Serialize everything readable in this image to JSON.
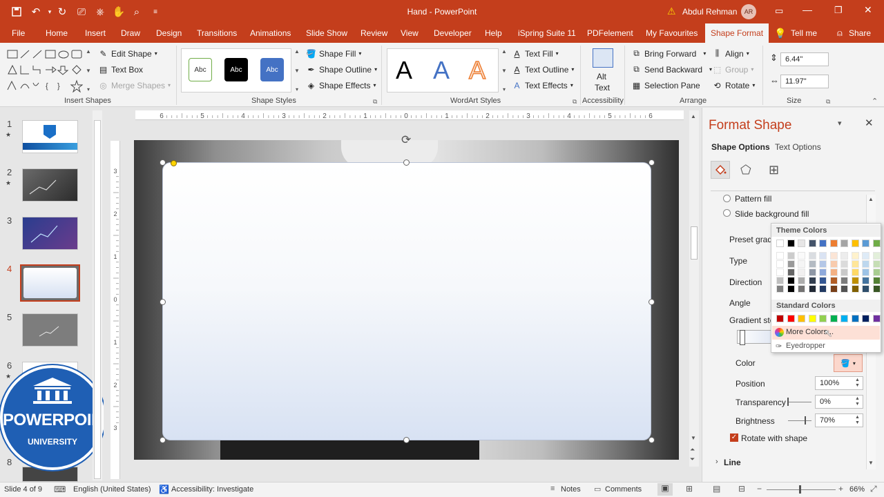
{
  "window": {
    "title": "Hand - PowerPoint",
    "user": "Abdul Rehman",
    "user_initials": "AR",
    "warning_icon": "warning-icon"
  },
  "tabs": [
    "File",
    "Home",
    "Insert",
    "Draw",
    "Design",
    "Transitions",
    "Animations",
    "Slide Show",
    "Review",
    "View",
    "Developer",
    "Help",
    "iSpring Suite 11",
    "PDFelement",
    "My Favourites",
    "Shape Format",
    "Tell me",
    "Share"
  ],
  "active_tab": "Shape Format",
  "ribbon": {
    "insert_shapes": {
      "label": "Insert Shapes",
      "edit_shape": "Edit Shape",
      "text_box": "Text Box",
      "merge_shapes": "Merge Shapes"
    },
    "shape_styles": {
      "label": "Shape Styles",
      "swatches": [
        "Abc",
        "Abc",
        "Abc"
      ],
      "shape_fill": "Shape Fill",
      "shape_outline": "Shape Outline",
      "shape_effects": "Shape Effects"
    },
    "wordart": {
      "label": "WordArt Styles",
      "letters": [
        "A",
        "A",
        "A"
      ],
      "text_fill": "Text Fill",
      "text_outline": "Text Outline",
      "text_effects": "Text Effects"
    },
    "accessibility": {
      "label": "Accessibility",
      "alt_text_1": "Alt",
      "alt_text_2": "Text"
    },
    "arrange": {
      "label": "Arrange",
      "bring_forward": "Bring Forward",
      "send_backward": "Send Backward",
      "selection_pane": "Selection Pane",
      "align": "Align",
      "group": "Group",
      "rotate": "Rotate"
    },
    "size": {
      "label": "Size",
      "height": "6.44\"",
      "width": "11.97\""
    }
  },
  "slides": [
    {
      "num": "1",
      "star": "★"
    },
    {
      "num": "2",
      "star": "★"
    },
    {
      "num": "3",
      "star": ""
    },
    {
      "num": "4",
      "star": ""
    },
    {
      "num": "5",
      "star": ""
    },
    {
      "num": "6",
      "star": "★"
    },
    {
      "num": "8",
      "star": ""
    }
  ],
  "ruler_h": [
    "6",
    "5",
    "4",
    "3",
    "2",
    "1",
    "0",
    "1",
    "2",
    "3",
    "4",
    "5",
    "6"
  ],
  "ruler_v": [
    "3",
    "2",
    "1",
    "0",
    "1",
    "2",
    "3"
  ],
  "watermark": {
    "line1": "POWERPOINT",
    "line2": "UNIVERSITY"
  },
  "format_pane": {
    "title": "Format Shape",
    "tab_shape": "Shape Options",
    "tab_text": "Text Options",
    "pattern_fill": "Pattern fill",
    "slide_bg_fill": "Slide background fill",
    "preset": "Preset gradi",
    "type": "Type",
    "direction": "Direction",
    "angle": "Angle",
    "gradient_stops": "Gradient sto",
    "color": "Color",
    "position": "Position",
    "position_val": "100%",
    "transparency": "Transparency",
    "transparency_val": "0%",
    "brightness": "Brightness",
    "brightness_val": "70%",
    "rotate_with_shape": "Rotate with shape",
    "line": "Line"
  },
  "color_popup": {
    "theme_colors": "Theme Colors",
    "standard_colors": "Standard Colors",
    "more_colors": "More Colors...",
    "eyedropper": "Eyedropper",
    "theme_top": [
      "#ffffff",
      "#000000",
      "#e7e6e6",
      "#44546a",
      "#4472c4",
      "#ed7d31",
      "#a5a5a5",
      "#ffc000",
      "#5b9bd5",
      "#70ad47"
    ],
    "standard": [
      "#c00000",
      "#ff0000",
      "#ffc000",
      "#ffff00",
      "#92d050",
      "#00b050",
      "#00b0f0",
      "#0070c0",
      "#002060",
      "#7030a0"
    ]
  },
  "status": {
    "slide": "Slide 4 of 9",
    "language": "English (United States)",
    "accessibility": "Accessibility: Investigate",
    "notes": "Notes",
    "comments": "Comments",
    "zoom": "66%"
  },
  "colors": {
    "accent": "#c43e1c"
  }
}
